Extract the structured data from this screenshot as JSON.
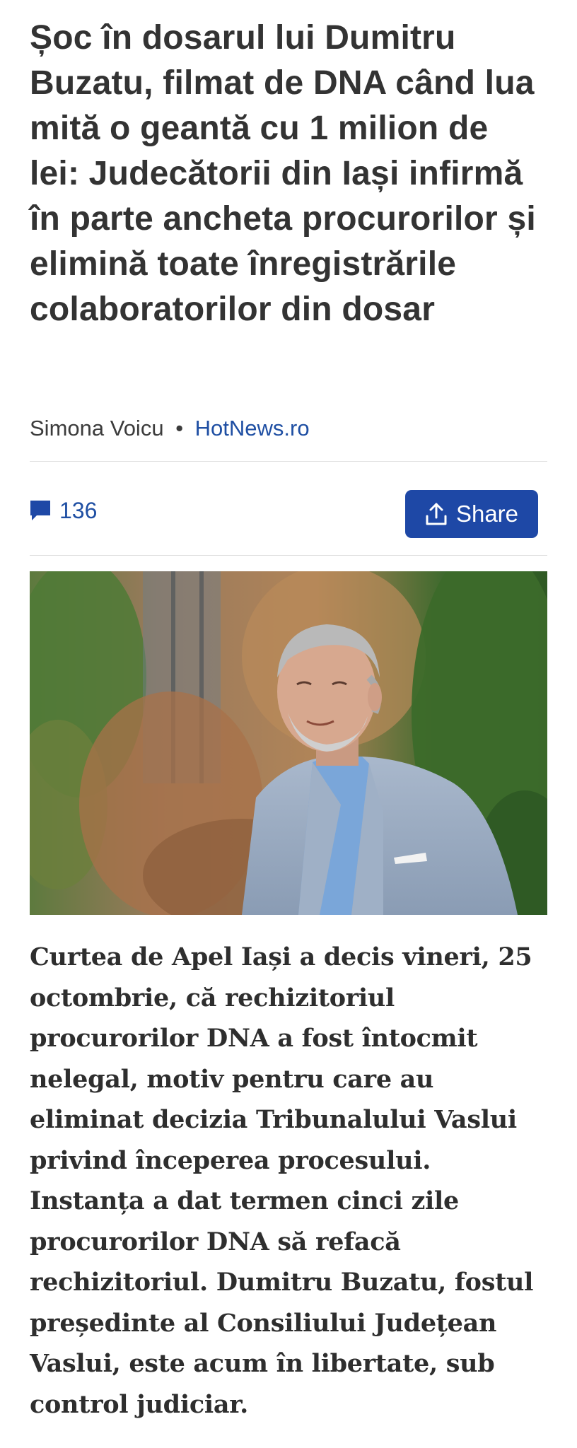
{
  "article": {
    "headline": "Șoc în dosarul lui Dumitru Buzatu, filmat de DNA când lua mită o geantă cu 1 milion de lei: Judecătorii din Iași infirmă în parte ancheta procurorilor și elimină toate înregistrările colaboratorilor din dosar",
    "author": "Simona Voicu",
    "separator": "•",
    "source": "HotNews.ro",
    "comment_count": "136",
    "share_label": "Share",
    "body": "Curtea de Apel Iași a decis vineri, 25 octombrie, că rechizitoriul procurorilor DNA a fost întocmit nelegal, motiv pentru care au eliminat decizia Tribunalului Vaslui privind începerea procesului. Instanța a dat termen cinci zile procurorilor DNA să refacă rechizitoriul. Dumitru Buzatu, fostul președinte al Consiliului Județean Vaslui, este acum în libertate, sub control judiciar."
  },
  "colors": {
    "accent": "#1e48a6",
    "link": "#1f4fa3",
    "divider": "#dedede",
    "text": "#333333"
  },
  "icons": {
    "comments": "comment-bubble-icon",
    "share": "share-upload-icon"
  }
}
